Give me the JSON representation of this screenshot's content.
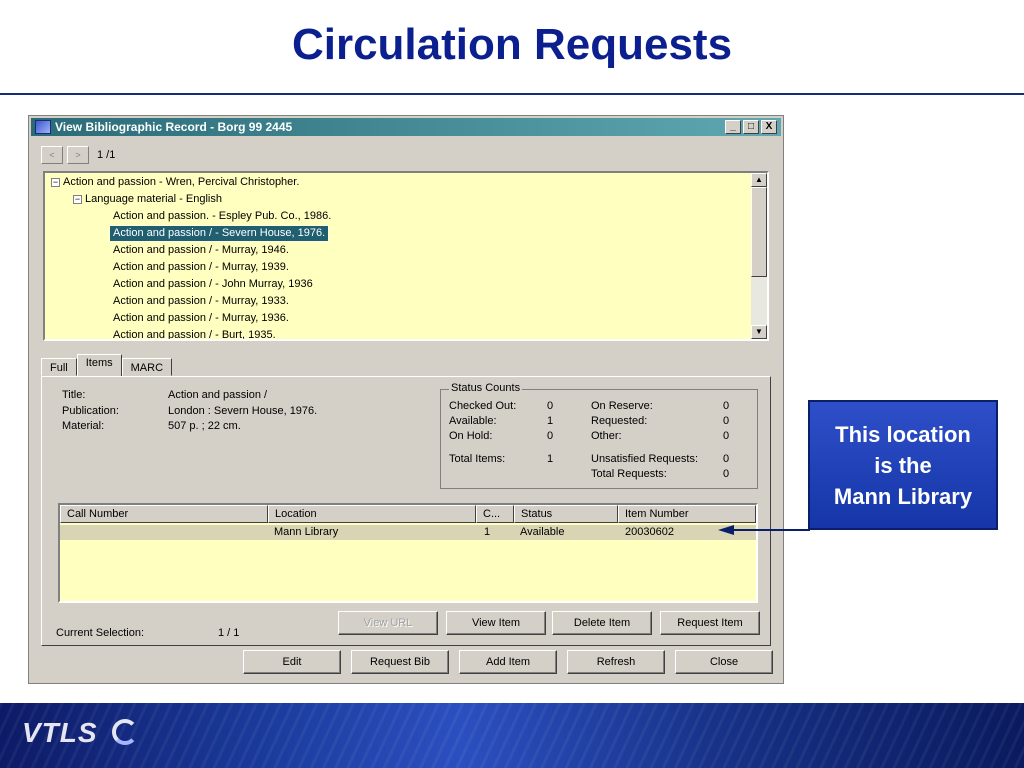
{
  "slide": {
    "title": "Circulation Requests",
    "callout": [
      "This location",
      "is the",
      "Mann Library"
    ]
  },
  "window": {
    "title": "View Bibliographic Record - Borg 99 2445",
    "controls": {
      "minimize": "_",
      "maximize": "□",
      "close": "X"
    },
    "nav": {
      "prev": "<",
      "next": ">",
      "count": "1 /1"
    }
  },
  "tree": {
    "root": "Action and passion - Wren, Percival Christopher.",
    "group": "Language material - English",
    "items": [
      "Action and passion. - Espley Pub. Co., 1986.",
      "Action and passion / - Severn House, 1976.",
      "Action and passion / - Murray, 1946.",
      "Action and passion / - Murray, 1939.",
      "Action and passion / - John Murray, 1936",
      "Action and passion / - Murray, 1933.",
      "Action and passion / - Murray, 1936.",
      "Action and passion / - Burt, 1935."
    ],
    "selected_index": 1
  },
  "tabs": [
    "Full",
    "Items",
    "MARC"
  ],
  "active_tab": "Items",
  "record": {
    "title_label": "Title:",
    "title_value": "Action and passion /",
    "publication_label": "Publication:",
    "publication_value": "London : Severn House, 1976.",
    "material_label": "Material:",
    "material_value": "507 p. ; 22 cm."
  },
  "status_counts": {
    "legend": "Status Counts",
    "checked_out_label": "Checked Out:",
    "checked_out": "0",
    "available_label": "Available:",
    "available": "1",
    "on_hold_label": "On Hold:",
    "on_hold": "0",
    "total_items_label": "Total Items:",
    "total_items": "1",
    "on_reserve_label": "On Reserve:",
    "on_reserve": "0",
    "requested_label": "Requested:",
    "requested": "0",
    "other_label": "Other:",
    "other": "0",
    "unsatisfied_label": "Unsatisfied Requests:",
    "unsatisfied": "0",
    "total_requests_label": "Total Requests:",
    "total_requests": "0"
  },
  "items_table": {
    "columns": [
      "Call Number",
      "Location",
      "C...",
      "Status",
      "Item Number"
    ],
    "rows": [
      {
        "call_number": "",
        "location": "Mann Library",
        "copy": "1",
        "status": "Available",
        "item_number": "20030602"
      }
    ]
  },
  "current_selection": {
    "label": "Current Selection:",
    "value": "1 / 1"
  },
  "item_buttons": {
    "view_url": "View URL",
    "view_item": "View Item",
    "delete_item": "Delete Item",
    "request_item": "Request Item"
  },
  "bottom_buttons": {
    "edit": "Edit",
    "request_bib": "Request Bib",
    "add_item": "Add Item",
    "refresh": "Refresh",
    "close": "Close"
  },
  "footer": {
    "logo": "VTLS"
  },
  "colors": {
    "title": "#0b1f8f",
    "titlebar": "#2a6b78",
    "tree_bg": "#ffffc0",
    "selection": "#1f5f70",
    "callout": "#1e3fbf"
  }
}
